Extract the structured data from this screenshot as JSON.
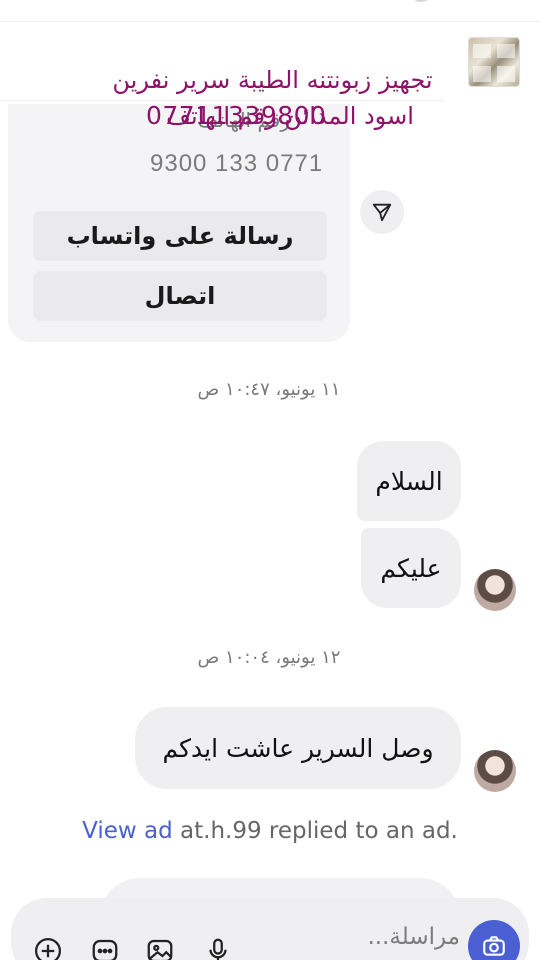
{
  "ad_header": {
    "title": "تجهيز زبونتنه الطيبة سرير نفرين",
    "subtitle": "اسود المدائن رقم الهاتف",
    "phone_overlay": "07711339800"
  },
  "contact_card": {
    "label": "رقم الهاتف",
    "phone": "9300 133 0771",
    "whatsapp_button": "رسالة على واتساب",
    "call_button": "اتصال"
  },
  "timestamps": {
    "first": "١١ يونيو، ١٠:٤٧ ص",
    "second": "١٢ يونيو، ١٠:٠٤ ص"
  },
  "messages": {
    "m1": "السلام",
    "m2": "عليكم",
    "m3": "وصل السرير عاشت ايدكم"
  },
  "reply_notice": {
    "link": "View ad",
    "text": " at.h.99 replied to an ad."
  },
  "composer": {
    "placeholder": "مراسلة..."
  },
  "icons": {
    "share": "send-share-icon",
    "camera": "camera-icon",
    "add": "add-circle-icon",
    "more": "more-icon",
    "image": "image-icon",
    "mic": "microphone-icon"
  },
  "colors": {
    "overlay_text": "#8f1268",
    "accent": "#4a5fd1",
    "bubble": "#efeff2"
  }
}
